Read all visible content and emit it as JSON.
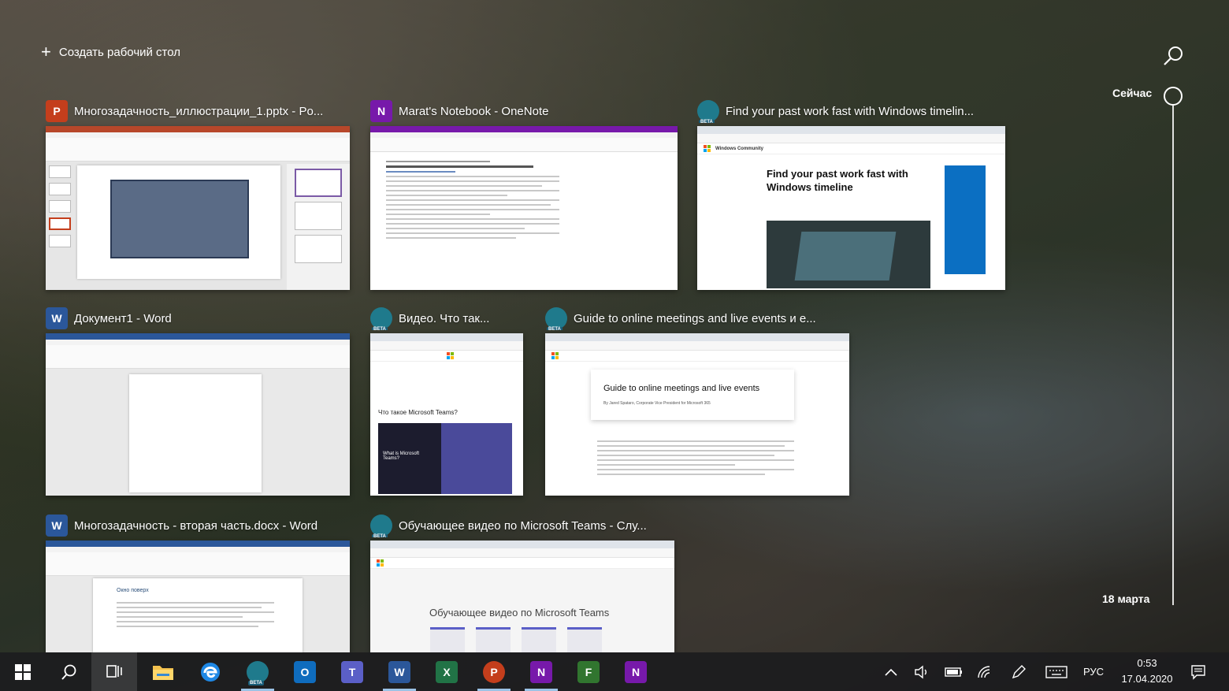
{
  "top": {
    "new_desktop_label": "Создать рабочий стол"
  },
  "timeline": {
    "now_label": "Сейчас",
    "date_label": "18 марта"
  },
  "windows": [
    {
      "title": "Многозадачность_иллюстрации_1.pptx - Po...",
      "app": "PowerPoint",
      "icon_letter": "P",
      "color": "#c43e1c"
    },
    {
      "title": "Marat's Notebook - OneNote",
      "app": "OneNote",
      "icon_letter": "N",
      "color": "#7719aa"
    },
    {
      "title": "Find your past work fast with Windows timelin...",
      "app": "Edge Beta",
      "icon_letter": "",
      "color": "#1f7a8c",
      "page_heading": "Find your past work fast with Windows timeline",
      "site": "Windows Community"
    },
    {
      "title": "Документ1 - Word",
      "app": "Word",
      "icon_letter": "W",
      "color": "#2b579a"
    },
    {
      "title": "Видео. Что так...",
      "app": "Edge Beta",
      "icon_letter": "",
      "color": "#1f7a8c",
      "page_heading": "Что такое Microsoft Teams?",
      "video_caption": "What is Microsoft Teams?"
    },
    {
      "title": "Guide to online meetings and live events и е...",
      "app": "Edge Beta",
      "icon_letter": "",
      "color": "#1f7a8c",
      "page_heading": "Guide to online meetings and live events",
      "byline": "By Jared Spataro, Corporate Vice President for Microsoft 365"
    },
    {
      "title": "Многозадачность - вторая часть.docx - Word",
      "app": "Word",
      "icon_letter": "W",
      "color": "#2b579a",
      "doc_heading": "Окно поверх"
    },
    {
      "title": "Обучающее видео по Microsoft Teams - Слу...",
      "app": "Edge Beta",
      "icon_letter": "",
      "color": "#1f7a8c",
      "page_heading": "Обучающее видео по Microsoft Teams"
    }
  ],
  "taskbar": {
    "apps": [
      {
        "name": "start",
        "icon": "windows-logo-icon"
      },
      {
        "name": "search",
        "icon": "search-icon"
      },
      {
        "name": "task-view",
        "icon": "task-view-icon"
      },
      {
        "name": "file-explorer",
        "icon": "folder-icon"
      },
      {
        "name": "edge",
        "icon": "edge-icon"
      },
      {
        "name": "edge-beta",
        "icon": "edge-beta-icon"
      },
      {
        "name": "outlook",
        "letter": "O",
        "color": "#0f6cbd"
      },
      {
        "name": "teams",
        "letter": "T",
        "color": "#5b5fc7"
      },
      {
        "name": "word",
        "letter": "W",
        "color": "#2b579a"
      },
      {
        "name": "excel",
        "letter": "X",
        "color": "#217346"
      },
      {
        "name": "powerpoint",
        "letter": "P",
        "color": "#c43e1c"
      },
      {
        "name": "onenote",
        "letter": "N",
        "color": "#7719aa"
      },
      {
        "name": "planner",
        "letter": "F",
        "color": "#31752f"
      },
      {
        "name": "onenote-2",
        "letter": "N",
        "color": "#7719aa"
      }
    ],
    "language": "РУС",
    "time": "0:53",
    "date": "17.04.2020"
  }
}
